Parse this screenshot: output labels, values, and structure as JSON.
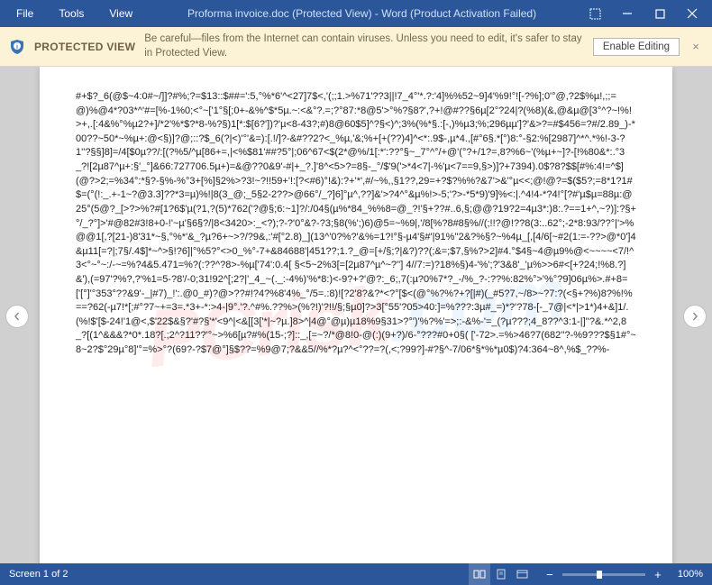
{
  "titlebar": {
    "menu": {
      "file": "File",
      "tools": "Tools",
      "view": "View"
    },
    "title": "Proforma invoice.doc (Protected View) - Word (Product Activation Failed)"
  },
  "warning": {
    "title": "PROTECTED VIEW",
    "text": "Be careful—files from the Internet can contain viruses. Unless you need to edit, it's safer to stay in Protected View.",
    "enable": "Enable Editing",
    "close": "×"
  },
  "document": {
    "text": "#+$?_6(@$~4:0#~/]]?#%;?=$13::$##=':5,°%*6'^<27]7$<,'(;;1.>%71'??3||!7_4°'*.?:'4]%%52~9]4'%9!°![-?%];0'°@,?2$%µ!,;;=@)%@4*?03*^'#=[%-1%0;<°~['1°§[;0+-&%^$*5µ.~:<&°?.=;?°87:*8@5'>°%?§8?',?+!@#??§6µ[2°?24|?(%8)(&,@&µ@[3°^?~!%!>+,.[:4&%°%µ2?+]/*2'%*$?*8-%?§)1[*:$[6?'])?'µ<8-43?;#)8@60$5]^?§<)^;3%(%*§.:[-,)%µ3;%;296µµ']?'&>?=#$456=?#/2.89_)-*00??~50*~%µ+:@<§)]?@;::?$_6(?|<)'°'&=):[.!/]?-&#??2?<_%µ,'&;%+[+(??)4]^<*:.9$-,µ*4.,[#°6§.*[°)8:°-§2:%[2987]^*^.*%!-3-?1''?§§]8]=/4[$0µ??/:[(?%5/^µ[86+=,|<%$81'##?5°|;06^67<$(2*@%/1[:*':??°§~_7°^°/+@'(°?+/1?=,8?%6~'(%µ+~]?-[!%80&*:.°3_?![2µ87^µ+:§'_°]&66:727706.5µ+)=&@??0&9'-#|+_?.]'8^<5>?=8§-_°/$'9('>*4<7|-%'µ<7==9,§>)]?+7394).0$?8?$$[#%:4!=^$](@?>2;=%34°:*§?-§%-%°3+[%]§2%>?3!~?!!59+'!:[?<#6)°!&):?+'*',#/~%,,§1??,29=+?$?%%?&7'>&'°µ<<;@!@?=$($5?;=8*1?1#$=(°(!:_.+-1~?@3.3]??*3=µ)%!|8(3_@;_5§2-2??>@66°/_?]6]°µ^,??]&'>?4^°&µ%!>-5;'?>-*5*9)'9]%<:|.^4!4-*?4!°[?#'µ$µ=88µ:@25°(5@?_[>?>%?#[1?6$'µ(?1,?(5)*762('?@§;6:~1]?/:/04§(µ%*84_%%8=@_?!'§+??#..6,§;@@?19?2=4µ3*:)8:.?==1+^,~?)]:?§+°/_?°]>'#@82#3!8+0-!'~µ'§6§?/|8<3420>:_<?);?-?'0°&?-?3;§8(%';)6)@5=~%9|,'/8[%?8#8§%//(;!!?@!??8(3:..62°;-2*8:93/??°|'>%@@1[,?[21-)8'31*~§,°%*'&_?µ?6+~>?/?9&,:'#[°2.8)_](13^'0?%?'&%=1?!°§-µ4'§#'|91%''2&?%§?~%4µ_[,[4/6[~#2(1:=-??>@*0']4&µ11[=?|;7§/.4$]*~^>§!?6]|°%5?°<>0_%°-7+&84688'|451??;1.?_@=[+/§;?|&?)??(;&=;$7,§%?>2]#4.°$4§~4@µ9%@<~~~~<7/!^3<°~°~:/-~=%?4&5.471=%?(:??^?8>-%µ['74':0.4[ §<5~2%3[=[2µ87^µ^~?''] 4//7:=)?18%§)4-'%';?'3&8'_'µ%>>6#<[+?24;!%8.?]&'),(=97'?%?,?'%1=5-?8'/-0;31!92^[;2?|'_4_~(._:-4%)'%*8:)<-9?+?'@?:_6;,7(:µ?0%7*?_-/%_?-:??%:82%°>'%°?9]06µ%>.#+8=['[°]'°353°??&9'-_|#7)_!':.@0_#)?@>??#!?4?%8'4%_°/5=.:8)![?2'8?&?*<?°[$<(@°%?%?+?[|#)(_#5?7,~/8>~?7:?(<§+?%)8?%!%==?62(-µ7!*[;#°?7~+=3=.*3+-*:>4-|9°.'?.^#%.??%>(%?!)'?!!/§;§µ0]?>3[°55'?05>40:]=%???:3µ#_=)*?'?78-[-_7@|<*|>1*)4+&]1/.(%!$'[$-24!'1@<,$'22$&§?'#?§'*'<9^|<&[[3['*|~?µ.]8>^|4@°@µ)µ18%9§31>?°')'%?%'=>;:-&%-'=_(?µ???;4_8??^3:1-|]''?&.*^2,8_?[(1^&&&?*0*.18?[.;2^?11??'°~>%6[µ?#%(15-;?]::_,[=~?/*@8!0-@(:)(9+?)/6-°???#0+0§( ['-72>.=%>46?7(682''?-%9???$§1#°~8~2?$°29µ°8]'°=%>°?(69?-?$7@°]§$??=%9@7;?&&5//%*?µ?^<°??=?(,<;?99?]-#?§^-7/06*§*%*µ0$)?4:364~8^,%$_??%-"
  },
  "watermark": {
    "line1": "PCrisk",
    "line2": ".com"
  },
  "status": {
    "screen": "Screen 1 of 2",
    "zoom": "100%"
  }
}
